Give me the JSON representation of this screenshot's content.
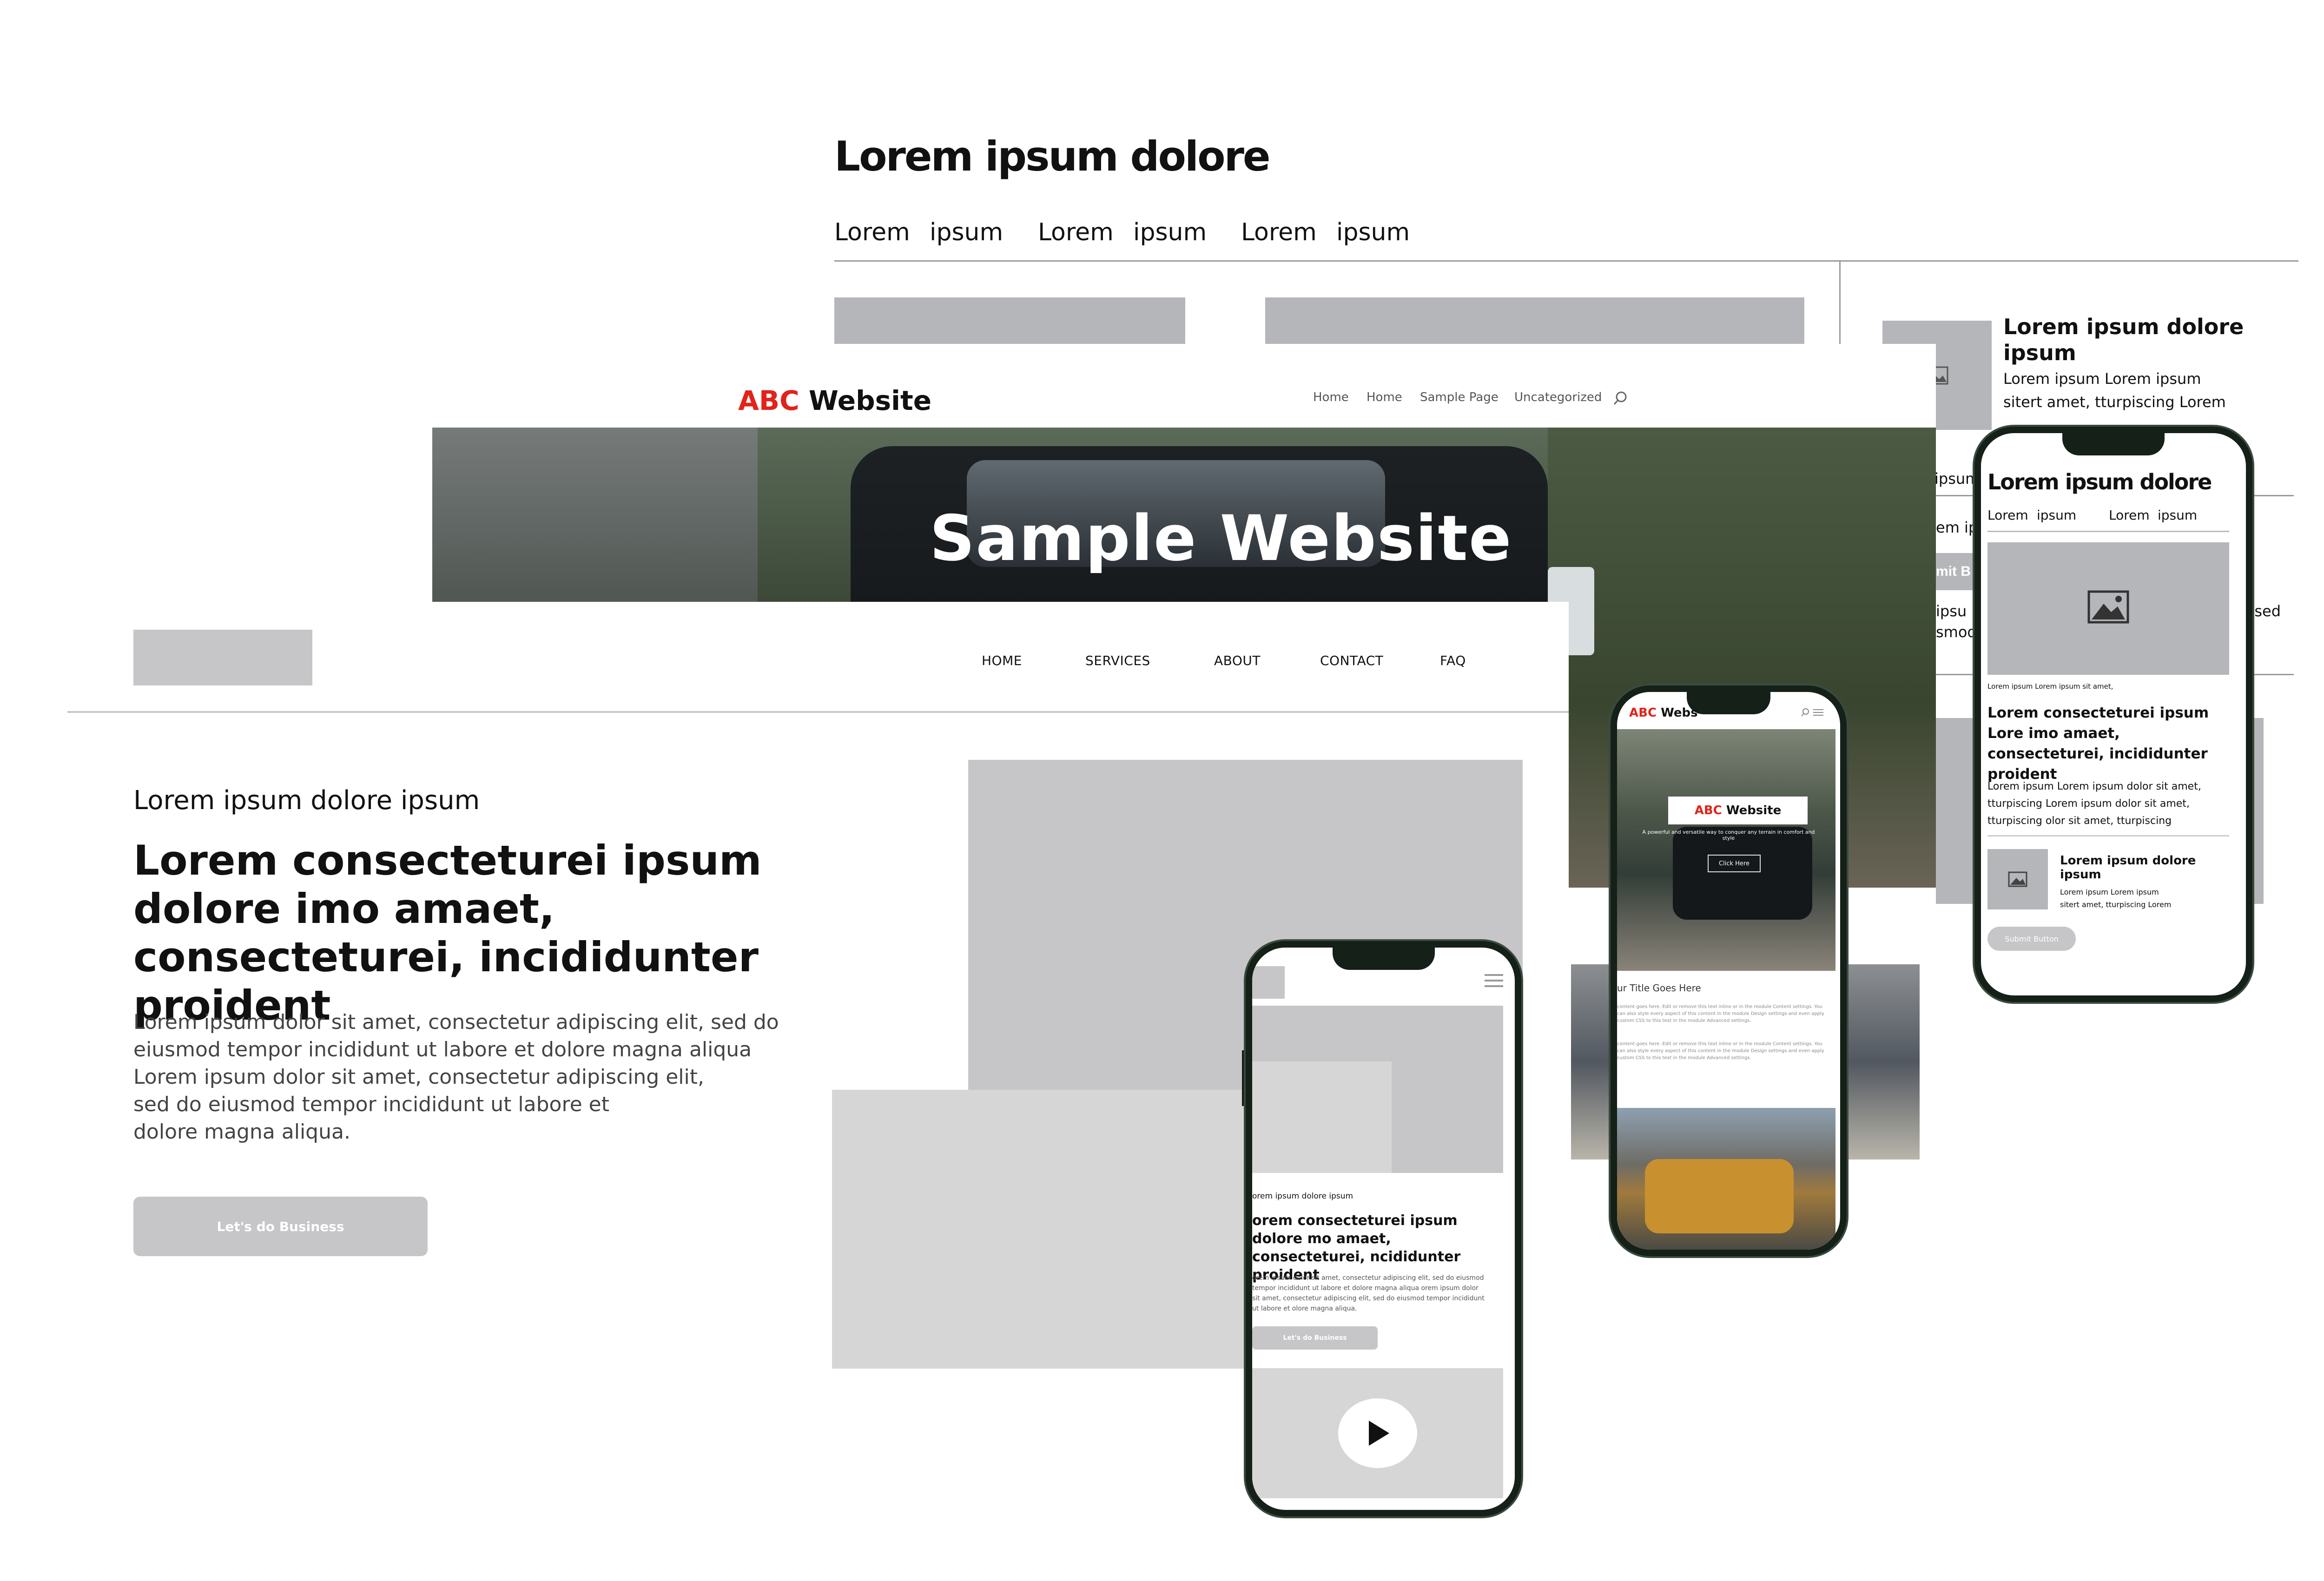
{
  "back_wireframe": {
    "title": "Lorem ipsum dolore",
    "nav": [
      "Lorem",
      "ipsum",
      "Lorem",
      "ipsum",
      "Lorem",
      "ipsum"
    ],
    "side": {
      "title": "Lorem ipsum dolore ipsum",
      "line1": "Lorem ipsum Lorem ipsum",
      "line2": "sitert amet, tturpiscing Lorem",
      "partial1": "ipsum",
      "partial2": "em ip",
      "partial3": "mit B",
      "partial4": "ipsu",
      "partial5": "smod",
      "partial6": ", sed"
    }
  },
  "car_site": {
    "logo_abc": "ABC",
    "logo_website": "Website",
    "nav": [
      "Home",
      "Home",
      "Sample Page",
      "Uncategorized"
    ],
    "hero_title": "Sample Website"
  },
  "front_wireframe": {
    "nav": [
      "HOME",
      "SERVICES",
      "ABOUT",
      "CONTACT",
      "FAQ"
    ],
    "eyebrow": "Lorem ipsum dolore ipsum",
    "headline": "Lorem  consecteturei ipsum dolore imo amaet, consecteturei, incididunter   proident",
    "paragraph_lines": [
      "Lorem ipsum dolor sit amet, consectetur adipiscing elit, sed do",
      "eiusmod tempor incididunt ut labore et dolore magna aliqua",
      "Lorem ipsum dolor sit amet, consectetur adipiscing elit,",
      "sed do eiusmod tempor incididunt ut labore et",
      "dolore magna aliqua."
    ],
    "cta": "Let's do Business"
  },
  "phone1": {
    "eyebrow": "orem ipsum dolore ipsum",
    "headline": "orem  consecteturei ipsum dolore mo amaet, consecteturei, ncididunter   proident",
    "para": "orem ipsum dolor sit amet, consectetur adipiscing elit, sed do eiusmod tempor incididunt ut labore et dolore magna aliqua orem ipsum dolor sit amet, consectetur adipiscing elit, sed do eiusmod tempor incididunt ut labore et olore magna aliqua.",
    "cta": "Let's do Business"
  },
  "phone2": {
    "logo_abc": "ABC",
    "logo_website": "Webs",
    "badge_abc": "ABC",
    "badge_website": "Website",
    "tagline": "A powerful and versatile way to conquer any terrain in comfort and style",
    "button": "Click Here",
    "section_title": "ur Title Goes Here",
    "body1": "content goes here. Edit or remove this text inline or in the module Content settings. You can also style every aspect of this content in the module Design settings and even apply custom CSS to this text in the module Advanced settings.",
    "body2": "content goes here. Edit or remove this text inline or in the module Content settings. You can also style every aspect of this content in the module Design settings and even apply custom CSS to this text in the module Advanced settings."
  },
  "phone3": {
    "title": "Lorem ipsum dolore",
    "nav": [
      "Lorem",
      "ipsum",
      "Lorem",
      "ipsum"
    ],
    "caption": "Lorem ipsum Lorem ipsum  sit amet,",
    "headline": "Lorem  consecteturei ipsum Lore imo amaet, consecteturei, incididunter  proident",
    "body": "Lorem ipsum Lorem ipsum dolor sit amet, tturpiscing Lorem ipsum dolor sit amet, tturpiscing  olor sit amet, tturpiscing",
    "card_title": "Lorem ipsum dolore ipsum",
    "card_line1": "Lorem ipsum Lorem ipsum",
    "card_line2": "sitert amet, tturpiscing Lorem",
    "button": "Submit Button"
  },
  "colors": {
    "brand_red": "#e2231a",
    "wire_gray": "#c6c6c8",
    "phone_frame": "#142018"
  }
}
